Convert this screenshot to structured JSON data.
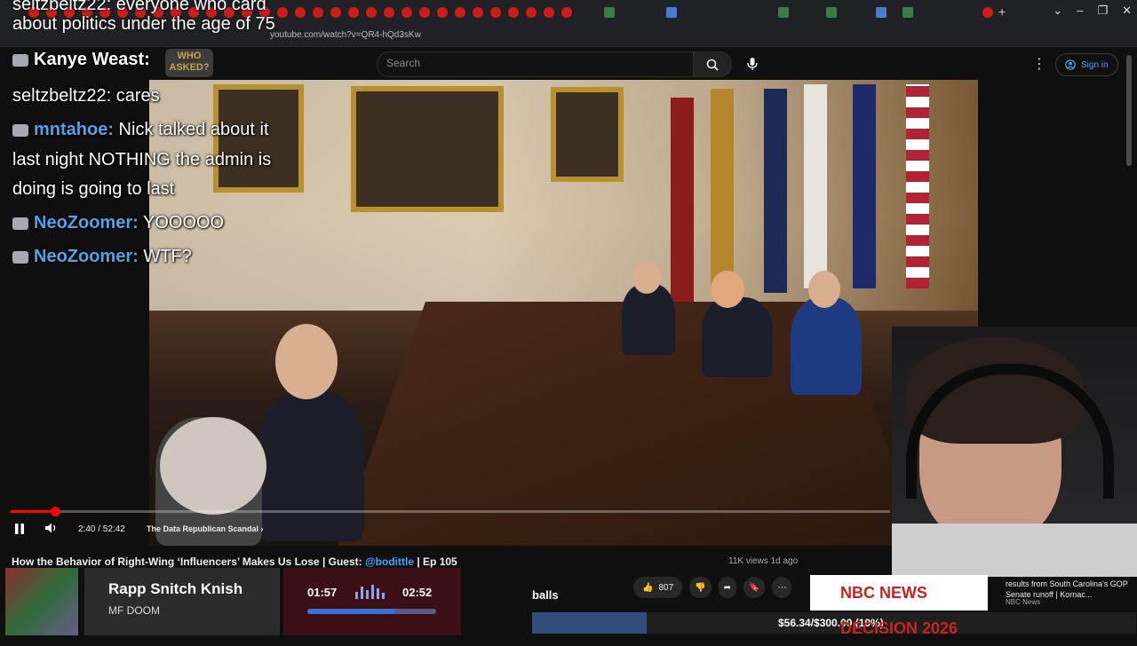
{
  "browser": {
    "url": "youtube.com/watch?v=QR4-hQd3sKw"
  },
  "youtube": {
    "search_placeholder": "Search",
    "sign_in": "Sign in",
    "video_title_main": "How the Behavior of Right-Wing ‘Influencers’ Makes Us Lose | Guest: ",
    "video_title_guest": "@bodittle",
    "video_title_ep": " | Ep 105",
    "views": "11K views  1d ago",
    "like_count": "807",
    "player": {
      "time": "2:40 / 52:42",
      "chapter": "The Data Republican Scandal",
      "progress_fraction": 0.051
    }
  },
  "stream_overlay": {
    "top_line_1": "seltzbeltz22: everyone who card",
    "top_line_2": "about politics under the age of 75",
    "chat": [
      {
        "user": "Kanye Weast:",
        "text": "",
        "user_color": "white",
        "badge": true
      },
      {
        "user": "seltzbeltz22:",
        "text": " cares",
        "user_color": "white",
        "badge": false
      },
      {
        "user": "mntahoe:",
        "text": " Nick talked about it",
        "user_color": "blue",
        "badge": true
      },
      {
        "user": "",
        "text": "last night NOTHING the admin is",
        "user_color": "white",
        "badge": false
      },
      {
        "user": "",
        "text": "doing is going to last",
        "user_color": "white",
        "badge": false
      },
      {
        "user": "NeoZoomer:",
        "text": " YOOOOO",
        "user_color": "blue",
        "badge": true
      },
      {
        "user": "NeoZoomer:",
        "text": " WTF?",
        "user_color": "blue",
        "badge": true
      }
    ],
    "who_badge": "WHO ASKED?",
    "now_playing": {
      "title": "Rapp Snitch Knish",
      "artist": "MF DOOM",
      "elapsed": "01:57",
      "total": "02:52",
      "progress_fraction": 0.68
    },
    "alert_text": "balls",
    "donation_goal": {
      "text": "$56.34/$300.00 (19%)",
      "fraction": 0.19
    },
    "news": {
      "logo": "NBC NEWS DECISION 2026",
      "headline": "results from South Carolina's GOP Senate runoff | Kornac...",
      "source": "NBC News"
    }
  },
  "colors": {
    "accent_red": "#ff0000",
    "link_blue": "#3ea6ff",
    "chat_user_blue": "#4fa3e8"
  }
}
